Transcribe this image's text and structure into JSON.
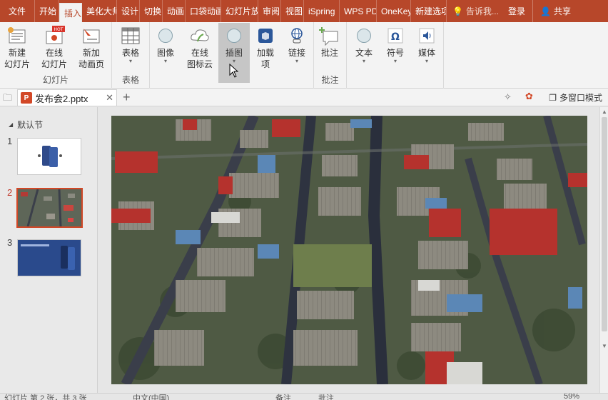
{
  "tabs": {
    "file": "文件",
    "items": [
      "开始",
      "插入",
      "美化大师",
      "设计",
      "切换",
      "动画",
      "口袋动画",
      "幻灯片放映",
      "审阅",
      "视图",
      "iSpring",
      "WPS PDF",
      "OneKey",
      "新建选项卡"
    ],
    "active_index": 1,
    "search": "告诉我...",
    "login": "登录",
    "share": "共享"
  },
  "ribbon": {
    "groups": {
      "slides": "幻灯片",
      "tables": "表格",
      "comments": "批注"
    },
    "buttons": {
      "new_slide": [
        "新建",
        "幻灯片"
      ],
      "online_slide": [
        "在线",
        "幻灯片"
      ],
      "add_anim_page": [
        "新加",
        "动画页"
      ],
      "table": "表格",
      "image": "图像",
      "online_icon": [
        "在线",
        "图标云"
      ],
      "illustration": "插图",
      "addins": [
        "加载",
        "项"
      ],
      "link": "链接",
      "comment": "批注",
      "text": "文本",
      "symbol": "符号",
      "media": "媒体"
    },
    "hot_badge": "HOT"
  },
  "document": {
    "badge": "P",
    "name": "发布会2.pptx",
    "multi_window": "多窗口模式"
  },
  "slide_panel": {
    "section": "默认节",
    "thumbs": [
      "1",
      "2",
      "3"
    ],
    "active": 2
  },
  "status": {
    "slide_info": "幻灯片 第 2 张，共 3 张",
    "language": "中文(中国)",
    "notes": "备注",
    "comments": "批注",
    "zoom": "59%"
  },
  "colors": {
    "accent": "#b7472a",
    "ribbon_bg": "#f3f3f3",
    "active_thumb": "#d24726"
  }
}
